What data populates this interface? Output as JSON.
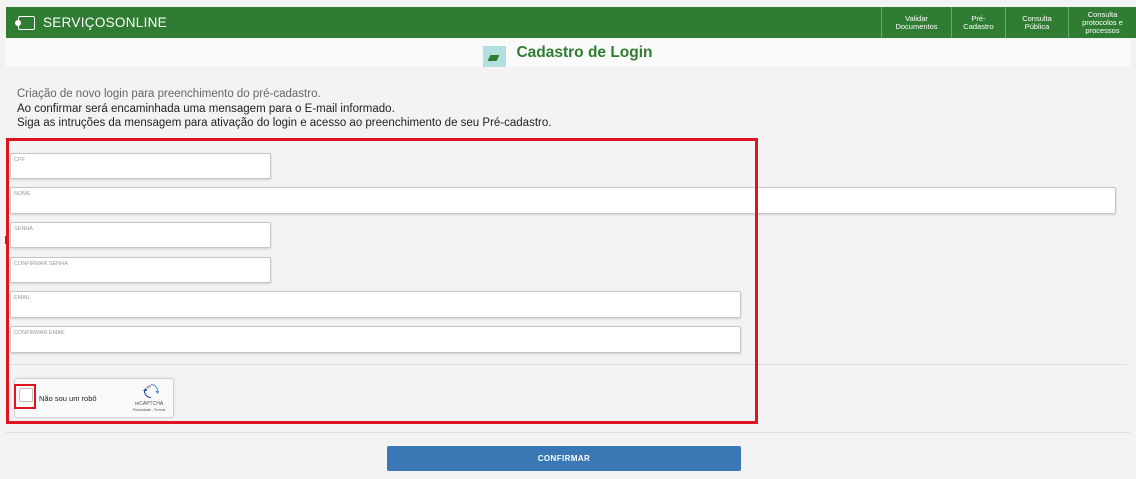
{
  "header": {
    "brand": "SERVIÇOSONLINE",
    "nav": [
      {
        "label": "Validar Documentos"
      },
      {
        "label": "Pré-Cadastro"
      },
      {
        "label": "Consulta Pública"
      },
      {
        "label": "Consulta protocolos e processos"
      }
    ]
  },
  "page": {
    "title": "Cadastro de Login"
  },
  "intro": {
    "line1": "Criação de novo login para preenchimento do pré-cadastro.",
    "line2": "Ao confirmar será encaminhada uma mensagem para o E-mail informado.",
    "line3": "Siga as intruções da mensagem para ativação do login e acesso ao preenchimento de seu Pré-cadastro."
  },
  "form": {
    "cpf": {
      "label": "CPF",
      "value": ""
    },
    "nome": {
      "label": "NOME",
      "value": ""
    },
    "senha": {
      "label": "SENHA",
      "value": ""
    },
    "confirmar_senha": {
      "label": "CONFIRMAR SENHA",
      "value": ""
    },
    "email": {
      "label": "EMAIL",
      "value": ""
    },
    "confirmar_email": {
      "label": "CONFIRMAR EMAIL",
      "value": ""
    }
  },
  "captcha": {
    "label": "Não sou um robô",
    "brand": "reCAPTCHA",
    "terms": "Privacidade - Termos",
    "icon": "recaptcha-icon"
  },
  "actions": {
    "confirm": "CONFIRMAR"
  },
  "colors": {
    "header_green": "#2e7d32",
    "title_green": "#2e7d32",
    "button_blue": "#3a78b5",
    "highlight_red": "#e0141e"
  }
}
